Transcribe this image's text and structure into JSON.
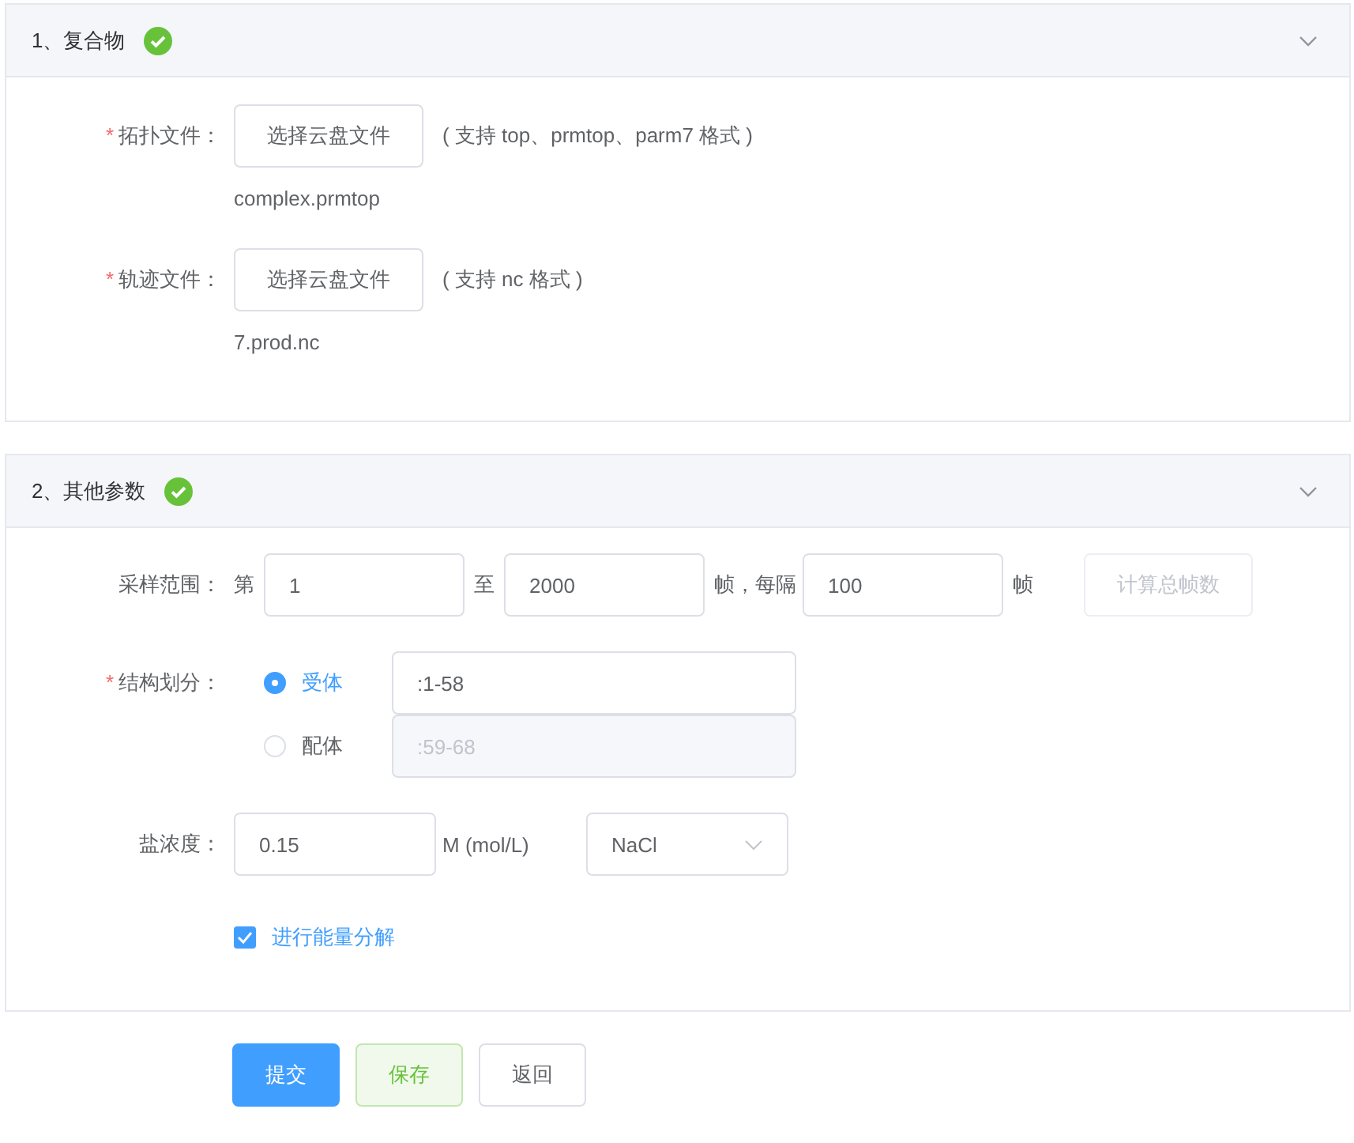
{
  "sections": [
    {
      "kind": "files",
      "title": "1、复合物",
      "complete": true,
      "expanded": true,
      "files": [
        {
          "label": "拓扑文件：",
          "required": "*",
          "button": "选择云盘文件",
          "hint": "( 支持 top、prmtop、parm7 格式 )",
          "filename": "complex.prmtop"
        },
        {
          "label": "轨迹文件：",
          "required": "*",
          "button": "选择云盘文件",
          "hint": "( 支持 nc 格式 )",
          "filename": "7.prod.nc"
        }
      ]
    },
    {
      "kind": "params",
      "title": "2、其他参数",
      "complete": true,
      "expanded": true,
      "sampling": {
        "label": "采样范围：",
        "prefix": "第",
        "start": "1",
        "to": "至",
        "end": "2000",
        "every": "帧，每隔",
        "step": "100",
        "suffix": "帧",
        "button": {
          "label": "计算总帧数",
          "disabled": true
        }
      },
      "structure": {
        "label": "结构划分：",
        "required": "*",
        "options": [
          {
            "label": "受体",
            "selected": true,
            "value": ":1-58",
            "disabled": false
          },
          {
            "label": "配体",
            "selected": false,
            "value": ":59-68",
            "disabled": true
          }
        ]
      },
      "salt": {
        "label": "盐浓度：",
        "value": "0.15",
        "unit": "M (mol/L)",
        "select": "NaCl"
      },
      "energy": {
        "label": "进行能量分解",
        "checked": true
      }
    }
  ],
  "actions": [
    {
      "label": "提交",
      "kind": "primary"
    },
    {
      "label": "保存",
      "kind": "success"
    },
    {
      "label": "返回",
      "kind": "default"
    }
  ]
}
